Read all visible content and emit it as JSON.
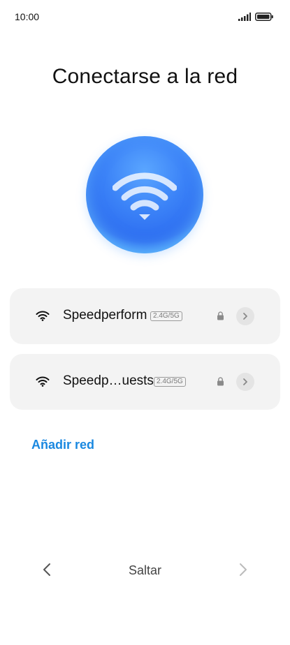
{
  "status_bar": {
    "time": "10:00"
  },
  "page": {
    "title": "Conectarse a la red"
  },
  "networks": [
    {
      "name": "Speedperform",
      "band": "2.4G/5G",
      "secured": true
    },
    {
      "name": "Speedp…uests",
      "band": "2.4G/5G",
      "secured": true
    }
  ],
  "actions": {
    "add_network": "Añadir red"
  },
  "footer": {
    "skip": "Saltar"
  },
  "colors": {
    "accent": "#1a88e0",
    "card_bg": "#f3f3f3",
    "hero_blue": "#3b82f7"
  }
}
